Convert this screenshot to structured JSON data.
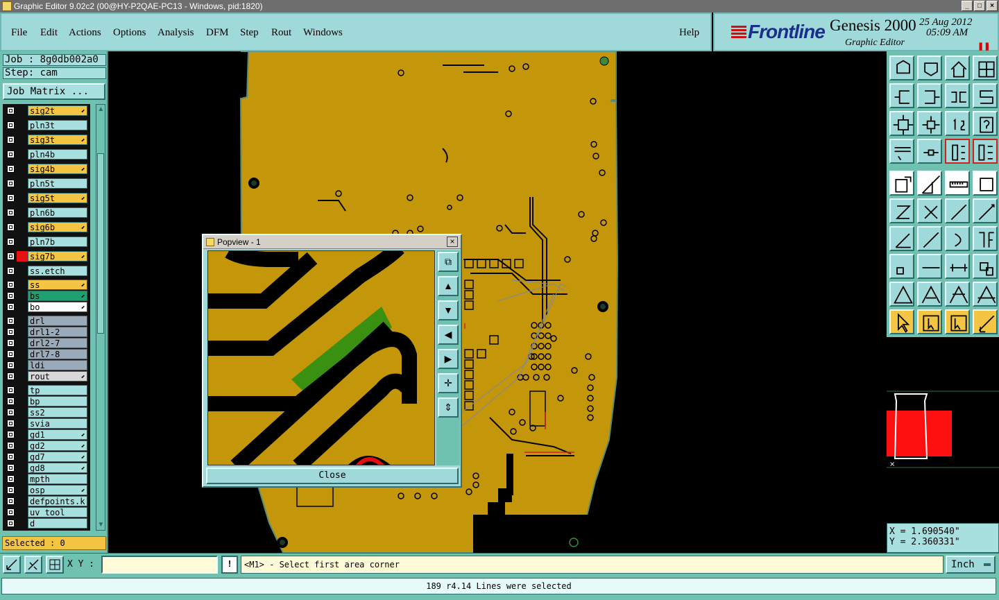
{
  "window": {
    "title": "Graphic Editor 9.02c2 (00@HY-P2QAE-PC13 - Windows, pid:1820)"
  },
  "menu": [
    "File",
    "Edit",
    "Actions",
    "Options",
    "Analysis",
    "DFM",
    "Step",
    "Rout",
    "Windows"
  ],
  "help": "Help",
  "logo": {
    "brand": "Frontline",
    "product": "Genesis 2000",
    "subtitle": "Graphic Editor",
    "date": "25 Aug 2012",
    "time": "05:09 AM"
  },
  "job": {
    "job_label": "Job : 8g0db002a0",
    "step_label": "Step: cam",
    "matrix_button": "Job Matrix ..."
  },
  "layers": [
    {
      "name": "sig2t",
      "color": "#f4c542",
      "mark": true
    },
    {
      "name": "pln3t",
      "color": "#a8e0e0",
      "mark": false
    },
    {
      "name": "sig3t",
      "color": "#f4c542",
      "mark": true
    },
    {
      "name": "pln4b",
      "color": "#a8e0e0",
      "mark": false
    },
    {
      "name": "sig4b",
      "color": "#f4c542",
      "mark": true
    },
    {
      "name": "pln5t",
      "color": "#a8e0e0",
      "mark": false
    },
    {
      "name": "sig5t",
      "color": "#f4c542",
      "mark": true
    },
    {
      "name": "pln6b",
      "color": "#a8e0e0",
      "mark": false
    },
    {
      "name": "sig6b",
      "color": "#f4c542",
      "mark": true
    },
    {
      "name": "pln7b",
      "color": "#a8e0e0",
      "mark": false
    },
    {
      "name": "sig7b",
      "color": "#f4c542",
      "mark": true
    },
    {
      "name": "ss.etch",
      "color": "#a8e0e0",
      "mark": false
    },
    {
      "name": "ss",
      "color": "#f4c542",
      "mark": true
    },
    {
      "name": "bs",
      "color": "#20a070",
      "mark": true
    },
    {
      "name": "bo",
      "color": "#ffffff",
      "mark": true
    },
    {
      "name": "drl",
      "color": "#9aaab8",
      "mark": false
    },
    {
      "name": "drl1-2",
      "color": "#9aaab8",
      "mark": false
    },
    {
      "name": "drl2-7",
      "color": "#9aaab8",
      "mark": false
    },
    {
      "name": "drl7-8",
      "color": "#9aaab8",
      "mark": false
    },
    {
      "name": "ldi",
      "color": "#9aaab8",
      "mark": false
    },
    {
      "name": "rout",
      "color": "#d8d8d8",
      "mark": true
    },
    {
      "name": "tp",
      "color": "#a8e0e0",
      "mark": false
    },
    {
      "name": "bp",
      "color": "#a8e0e0",
      "mark": false
    },
    {
      "name": "ss2",
      "color": "#a8e0e0",
      "mark": false
    },
    {
      "name": "svia",
      "color": "#a8e0e0",
      "mark": false
    },
    {
      "name": "gd1",
      "color": "#a8e0e0",
      "mark": true
    },
    {
      "name": "gd2",
      "color": "#a8e0e0",
      "mark": true
    },
    {
      "name": "gd7",
      "color": "#a8e0e0",
      "mark": true
    },
    {
      "name": "gd8",
      "color": "#a8e0e0",
      "mark": true
    },
    {
      "name": "mpth",
      "color": "#a8e0e0",
      "mark": false
    },
    {
      "name": "osp",
      "color": "#a8e0e0",
      "mark": true
    },
    {
      "name": "defpoints.k",
      "color": "#a8e0e0",
      "mark": false
    },
    {
      "name": "uv_tool",
      "color": "#a8e0e0",
      "mark": false
    },
    {
      "name": "d",
      "color": "#a8e0e0",
      "mark": false
    }
  ],
  "selected_text": "Selected : 0",
  "popview": {
    "title": "Popview - 1",
    "close_button": "Close"
  },
  "coords": {
    "x": "X = 1.690540\"",
    "y": "Y = 2.360331\""
  },
  "bottom": {
    "xy_label": "X Y :",
    "xy_value": "",
    "prompt": "<M1> - Select first area corner",
    "units": "Inch",
    "status": "189 r4.14 Lines were selected"
  },
  "colors": {
    "board": "#c4960a",
    "panel": "#6fc2b0",
    "menu_bg": "#9fd9d9",
    "selected_layer": "#20a070"
  }
}
